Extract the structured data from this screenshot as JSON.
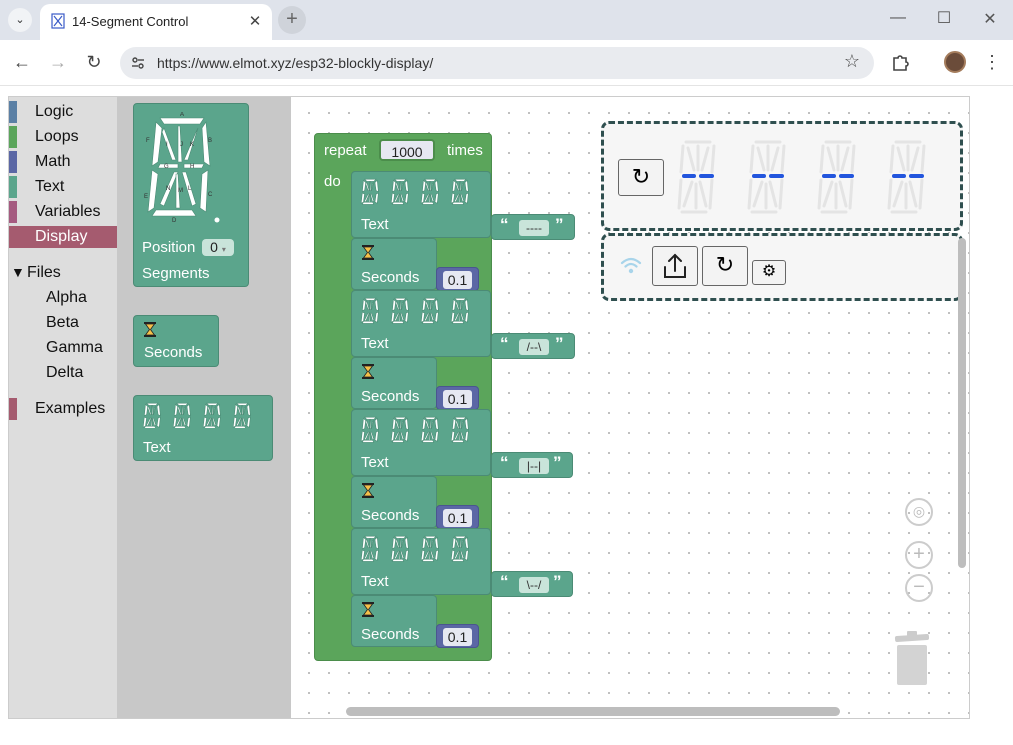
{
  "browser": {
    "tab_title": "14-Segment Control",
    "url": "https://www.elmot.xyz/esp32-blockly-display/",
    "new_tab": "+",
    "tab_close": "✕"
  },
  "toolbox": {
    "categories": [
      {
        "label": "Logic",
        "color": "#5b80a5"
      },
      {
        "label": "Loops",
        "color": "#5ba55b"
      },
      {
        "label": "Math",
        "color": "#5b67a5"
      },
      {
        "label": "Text",
        "color": "#5ba58c"
      },
      {
        "label": "Variables",
        "color": "#a55b80"
      },
      {
        "label": "Display",
        "color": "#a55b6f"
      }
    ],
    "files_label": "Files",
    "files_arrow": "▼",
    "files": [
      "Alpha",
      "Beta",
      "Gamma",
      "Delta"
    ],
    "examples_label": "Examples",
    "examples_color": "#a55b6f"
  },
  "flyout": {
    "position_label": "Position",
    "position_value": "0",
    "segments_label": "Segments",
    "seconds_label": "Seconds",
    "text_label": "Text"
  },
  "program": {
    "repeat_label": "repeat",
    "repeat_count": "1000",
    "times_label": "times",
    "do_label": "do",
    "steps": [
      {
        "text_label": "Text",
        "text_value": "----",
        "seconds_label": "Seconds",
        "seconds_value": "0.1"
      },
      {
        "text_label": "Text",
        "text_value": "/--\\",
        "seconds_label": "Seconds",
        "seconds_value": "0.1"
      },
      {
        "text_label": "Text",
        "text_value": "|--|",
        "seconds_label": "Seconds",
        "seconds_value": "0.1"
      },
      {
        "text_label": "Text",
        "text_value": "\\--/",
        "seconds_label": "Seconds",
        "seconds_value": "0.1"
      }
    ]
  },
  "colors": {
    "block_text": "#5ba58c",
    "block_math": "#5b67a5",
    "display_active": "#2255dd",
    "panel_border": "#2f4f4f"
  }
}
